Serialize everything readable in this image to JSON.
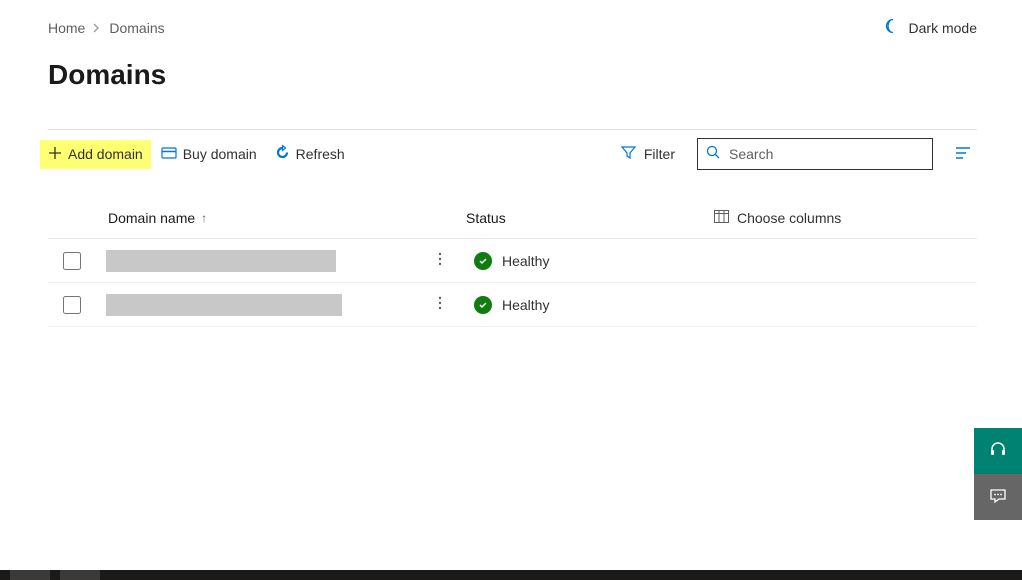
{
  "breadcrumb": {
    "home": "Home",
    "current": "Domains"
  },
  "header": {
    "dark_mode": "Dark mode",
    "title": "Domains"
  },
  "toolbar": {
    "add_domain": "Add domain",
    "buy_domain": "Buy domain",
    "refresh": "Refresh",
    "filter": "Filter",
    "search_placeholder": "Search"
  },
  "table": {
    "headers": {
      "domain_name": "Domain name",
      "status": "Status",
      "choose_columns": "Choose columns"
    },
    "rows": [
      {
        "domain": "",
        "status": "Healthy"
      },
      {
        "domain": "",
        "status": "Healthy"
      }
    ]
  },
  "colors": {
    "accent": "#0078d4",
    "highlight": "#ffff73",
    "healthy": "#107c10",
    "teal": "#008272"
  }
}
